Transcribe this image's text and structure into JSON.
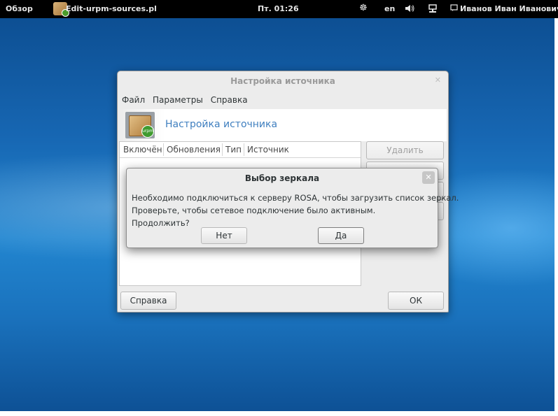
{
  "topbar": {
    "activities": "Обзор",
    "app_name": "Edit-urpm-sources.pl",
    "clock": "Пт. 01:26",
    "language": "en",
    "user": "Иванов Иван Иванович"
  },
  "main_window": {
    "title": "Настройка источника",
    "menu": [
      "Файл",
      "Параметры",
      "Справка"
    ],
    "banner_title": "Настройка источника",
    "table_headers": [
      "Включён",
      "Обновления",
      "Тип",
      "Источник"
    ],
    "side_buttons": {
      "remove": "Удалить"
    },
    "help_button": "Справка",
    "ok_button": "ОК",
    "badge_text": "urpmi"
  },
  "modal": {
    "title": "Выбор зеркала",
    "message_lines": [
      "Необходимо подключиться к серверу ROSA, чтобы загрузить список зеркал.",
      "Проверьте, чтобы сетевое подключение было активным.",
      "Продолжить?"
    ],
    "no_button": "Нет",
    "yes_button": "Да"
  }
}
